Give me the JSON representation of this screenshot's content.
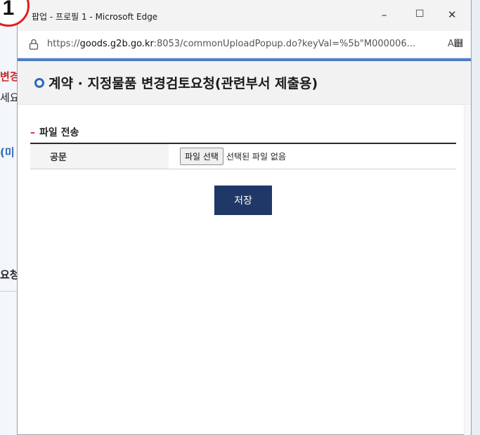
{
  "background": {
    "fragments": [
      "변경",
      "세요",
      "(미",
      "요청"
    ]
  },
  "badge": {
    "number": "1"
  },
  "window": {
    "title": "팝업 - 프로필 1 - Microsoft Edge",
    "minimize_glyph": "–",
    "maximize_glyph": "☐",
    "close_glyph": "✕"
  },
  "address": {
    "prefix": "https://",
    "host": "goods.g2b.go.kr",
    "rest": ":8053/commonUploadPopup.do?keyVal=%5b\"M000006...",
    "read_aloud": "A୽"
  },
  "header": {
    "title": "계약 · 지정물품 변경검토요청(관련부서 제출용)"
  },
  "section": {
    "dash": "–",
    "title": "파일 전송"
  },
  "form": {
    "label": "공문",
    "file_button": "파일 선택",
    "file_status": "선택된 파일 없음"
  },
  "actions": {
    "save_label": "저장"
  },
  "colors": {
    "accent_blue": "#4a7fc8",
    "save_button": "#1f3867",
    "section_dash": "#c8262a",
    "badge_ring": "#e02020"
  }
}
